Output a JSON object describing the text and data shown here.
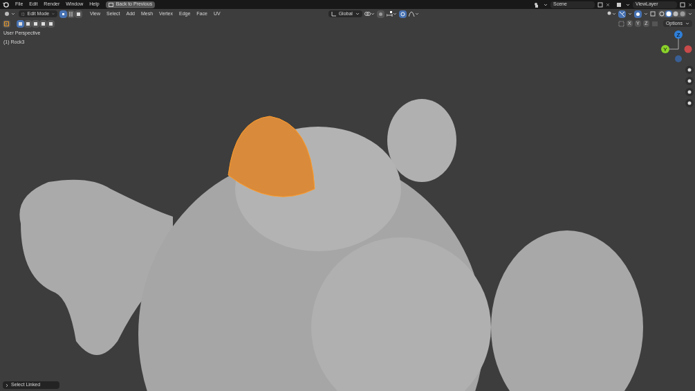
{
  "top_menu": [
    "File",
    "Edit",
    "Render",
    "Window",
    "Help"
  ],
  "back_button": "Back to Previous",
  "scene": "Scene",
  "view_layer": "ViewLayer",
  "header": {
    "mode": "Edit Mode",
    "select_modes": [
      {
        "kind": "vertex",
        "selected": true
      },
      {
        "kind": "edge",
        "selected": false
      },
      {
        "kind": "face",
        "selected": false
      }
    ],
    "menus": [
      "View",
      "Select",
      "Add",
      "Mesh",
      "Vertex",
      "Edge",
      "Face",
      "UV"
    ],
    "orientation": "Global",
    "snap_on": false,
    "proportional_on": true,
    "shading": [
      {
        "kind": "wireframe",
        "selected": false
      },
      {
        "kind": "solid",
        "selected": true
      },
      {
        "kind": "material",
        "selected": false
      },
      {
        "kind": "rendered",
        "selected": false
      }
    ],
    "mirror_axes": [
      {
        "label": "X",
        "on": false
      },
      {
        "label": "Y",
        "on": false
      },
      {
        "label": "Z",
        "on": false
      }
    ],
    "options": "Options"
  },
  "tool_modes": [
    {
      "selected": true
    },
    {
      "selected": false
    },
    {
      "selected": false
    },
    {
      "selected": false
    },
    {
      "selected": false
    }
  ],
  "viewport": {
    "view_name": "User Perspective",
    "object_name": "(1) Rock3",
    "gizmo": [
      {
        "label": "Z",
        "color": "#2f7fd8"
      },
      {
        "label": "Y",
        "color": "#8bd22a"
      }
    ]
  },
  "last_operator": "Select Linked"
}
